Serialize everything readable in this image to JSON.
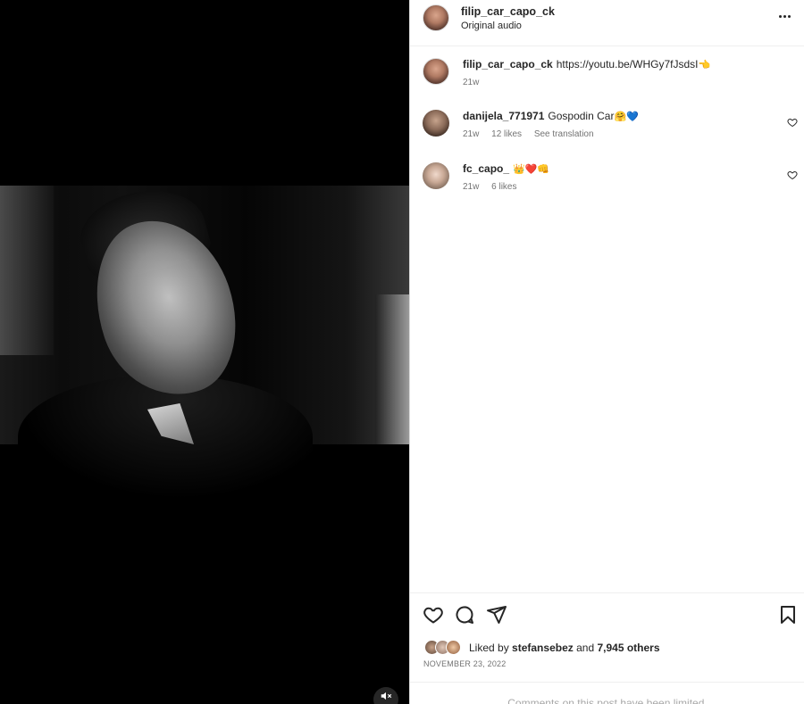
{
  "post": {
    "owner": "filip_car_capo_ck",
    "audio": "Original audio"
  },
  "comments": [
    {
      "username": "filip_car_capo_ck",
      "text": "https://youtu.be/WHGy7fJsdsI",
      "emoji": "👈",
      "time": "21w",
      "likes": "",
      "extra": ""
    },
    {
      "username": "danijela_771971",
      "text": "Gospodin Car",
      "emoji": "🤗💙",
      "time": "21w",
      "likes": "12 likes",
      "extra": "See translation"
    },
    {
      "username": "fc_capo_",
      "text": "",
      "emoji": "👑❤️👊",
      "time": "21w",
      "likes": "6 likes",
      "extra": ""
    }
  ],
  "actions": {
    "liked_prefix": "Liked by",
    "liked_user": "stefansebez",
    "liked_and": "and",
    "liked_others": "7,945 others",
    "date": "NOVEMBER 23, 2022",
    "comments_limited": "Comments on this post have been limited."
  },
  "icons": {
    "more": "more-options-icon",
    "like": "heart-icon",
    "comment": "comment-icon",
    "share": "share-icon",
    "save": "bookmark-icon",
    "mute": "muted-speaker-icon"
  },
  "colors": {
    "text": "#262626",
    "secondary": "#737373",
    "divider": "#efefef"
  }
}
